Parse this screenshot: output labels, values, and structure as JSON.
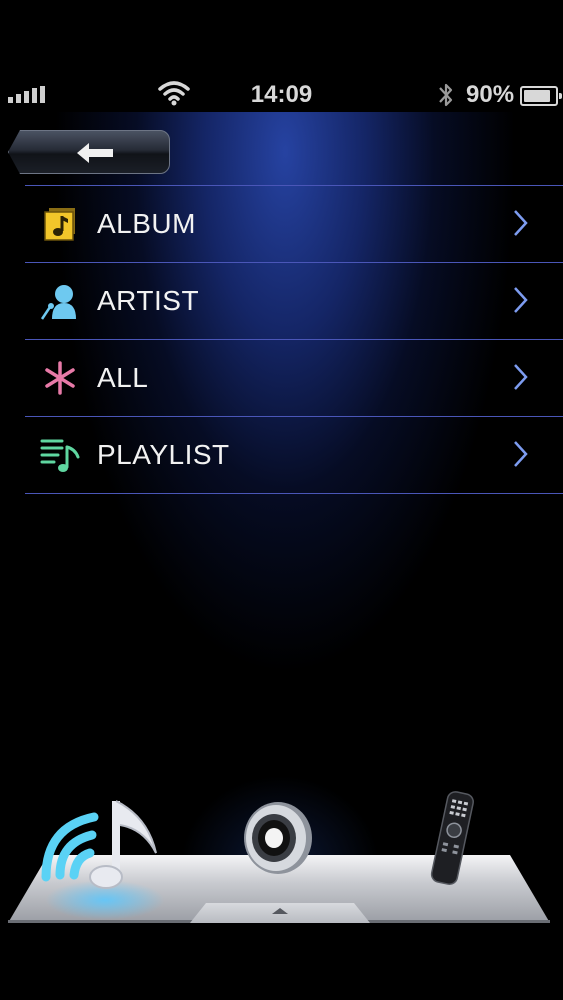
{
  "status_bar": {
    "time": "14:09",
    "battery_percent": "90%",
    "battery_level": 0.9,
    "icons": [
      "signal-bars-icon",
      "wifi-icon",
      "bluetooth-icon",
      "battery-icon"
    ]
  },
  "navigation": {
    "back_icon": "left-arrow-icon"
  },
  "menu": {
    "items": [
      {
        "label": "ALBUM",
        "icon": "album-icon",
        "icon_color": "#f2c62a"
      },
      {
        "label": "ARTIST",
        "icon": "artist-icon",
        "icon_color": "#6ec9f0"
      },
      {
        "label": "ALL",
        "icon": "asterisk-icon",
        "icon_color": "#e87aa8"
      },
      {
        "label": "PLAYLIST",
        "icon": "playlist-icon",
        "icon_color": "#5fd6a0"
      }
    ],
    "chevron_icon": "chevron-right-icon",
    "divider_color": "#4a56b8"
  },
  "dock": {
    "buttons": [
      {
        "name": "network-music",
        "icon": "network-music-icon"
      },
      {
        "name": "speaker",
        "icon": "speaker-icon"
      },
      {
        "name": "remote",
        "icon": "remote-control-icon"
      }
    ],
    "tab_icon": "up-arrow-icon"
  },
  "colors": {
    "background": "#000000",
    "spotlight": "#2846aa",
    "text": "#f2f2f2"
  }
}
